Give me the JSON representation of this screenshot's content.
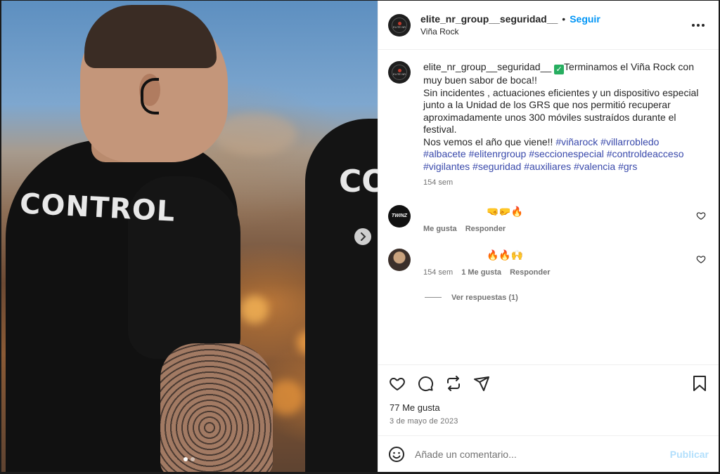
{
  "post": {
    "username": "elite_nr_group__seguridad__",
    "follow_label": "Seguir",
    "separator": "•",
    "location": "Viña Rock",
    "avatar_text": "ELITE NR",
    "more_icon": "more-horizontal-icon"
  },
  "image": {
    "shirt_text": "CONTROL",
    "shirt_text_2": "CO",
    "next_icon": "chevron-right-icon",
    "carousel_count": 2,
    "carousel_active": 0
  },
  "caption": {
    "username": "elite_nr_group__seguridad__",
    "check_emoji": "✓",
    "line1": "Terminamos el Viña Rock con muy buen sabor de boca!!",
    "line2": "Sin incidentes , actuaciones eficientes y un dispositivo especial junto a la Unidad de los GRS que nos permitió recuperar aproximadamente unos 300 móviles sustraídos durante el festival.",
    "line3": "Nos vemos el año que viene!!",
    "hashtags": [
      "#viñarock",
      "#villarrobledo",
      "#albacete",
      "#elitenrgroup",
      "#seccionespecial",
      "#controldeacceso",
      "#vigilantes",
      "#seguridad",
      "#auxiliares",
      "#valencia",
      "#grs"
    ],
    "time": "154 sem"
  },
  "comments": [
    {
      "avatar_text": "TWINZ",
      "text": "🤜🤛🔥",
      "time": "",
      "likes": "Me gusta",
      "reply": "Responder"
    },
    {
      "avatar_text": "",
      "text": "🔥🔥🙌",
      "time": "154 sem",
      "likes": "1 Me gusta",
      "reply": "Responder",
      "view_replies": "Ver respuestas (1)"
    }
  ],
  "actions": {
    "icons": [
      "heart-icon",
      "comment-icon",
      "repost-icon",
      "share-icon",
      "bookmark-icon"
    ],
    "likes": "77 Me gusta",
    "date": "3 de mayo de 2023"
  },
  "composer": {
    "placeholder": "Añade un comentario...",
    "publish": "Publicar",
    "emoji_icon": "emoji-icon"
  },
  "colors": {
    "accent": "#0095f6",
    "hashtag": "#3949ab",
    "publish_disabled": "#b2dffc"
  }
}
